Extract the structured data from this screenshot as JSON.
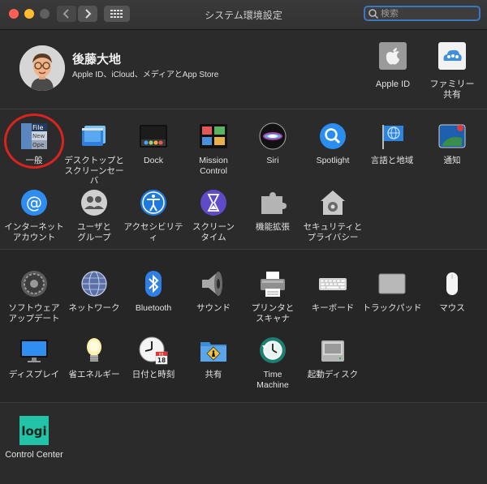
{
  "window": {
    "title": "システム環境設定"
  },
  "search": {
    "placeholder": "検索"
  },
  "account": {
    "name": "後藤大地",
    "subtitle": "Apple ID、iCloud、メディアとApp Store",
    "apple_id_label": "Apple ID",
    "family_label": "ファミリー\n共有"
  },
  "rows": {
    "row1": [
      {
        "label": "一般",
        "icon": "general-icon"
      },
      {
        "label": "デスクトップと\nスクリーンセーバ",
        "icon": "desktop-icon"
      },
      {
        "label": "Dock",
        "icon": "dock-icon"
      },
      {
        "label": "Mission\nControl",
        "icon": "mission-control-icon"
      },
      {
        "label": "Siri",
        "icon": "siri-icon"
      },
      {
        "label": "Spotlight",
        "icon": "spotlight-icon"
      },
      {
        "label": "言語と地域",
        "icon": "language-region-icon"
      },
      {
        "label": "通知",
        "icon": "notifications-icon"
      }
    ],
    "row2": [
      {
        "label": "インターネット\nアカウント",
        "icon": "internet-accounts-icon"
      },
      {
        "label": "ユーザと\nグループ",
        "icon": "users-groups-icon"
      },
      {
        "label": "アクセシビリティ",
        "icon": "accessibility-icon"
      },
      {
        "label": "スクリーン\nタイム",
        "icon": "screen-time-icon"
      },
      {
        "label": "機能拡張",
        "icon": "extensions-icon"
      },
      {
        "label": "セキュリティと\nプライバシー",
        "icon": "security-privacy-icon"
      }
    ],
    "row3": [
      {
        "label": "ソフトウェア\nアップデート",
        "icon": "software-update-icon"
      },
      {
        "label": "ネットワーク",
        "icon": "network-icon"
      },
      {
        "label": "Bluetooth",
        "icon": "bluetooth-icon"
      },
      {
        "label": "サウンド",
        "icon": "sound-icon"
      },
      {
        "label": "プリンタと\nスキャナ",
        "icon": "printers-scanners-icon"
      },
      {
        "label": "キーボード",
        "icon": "keyboard-icon"
      },
      {
        "label": "トラックパッド",
        "icon": "trackpad-icon"
      },
      {
        "label": "マウス",
        "icon": "mouse-icon"
      }
    ],
    "row4": [
      {
        "label": "ディスプレイ",
        "icon": "displays-icon"
      },
      {
        "label": "省エネルギー",
        "icon": "energy-saver-icon"
      },
      {
        "label": "日付と時刻",
        "icon": "date-time-icon"
      },
      {
        "label": "共有",
        "icon": "sharing-icon"
      },
      {
        "label": "Time\nMachine",
        "icon": "time-machine-icon"
      },
      {
        "label": "起動ディスク",
        "icon": "startup-disk-icon"
      }
    ],
    "row5": [
      {
        "label": "Control Center",
        "icon": "logi-control-center-icon"
      }
    ]
  },
  "icon_text": {
    "general_file": "File",
    "general_new": "New",
    "general_open": "Ope",
    "logi": "logi",
    "date_month": "JUL",
    "date_day": "18"
  }
}
